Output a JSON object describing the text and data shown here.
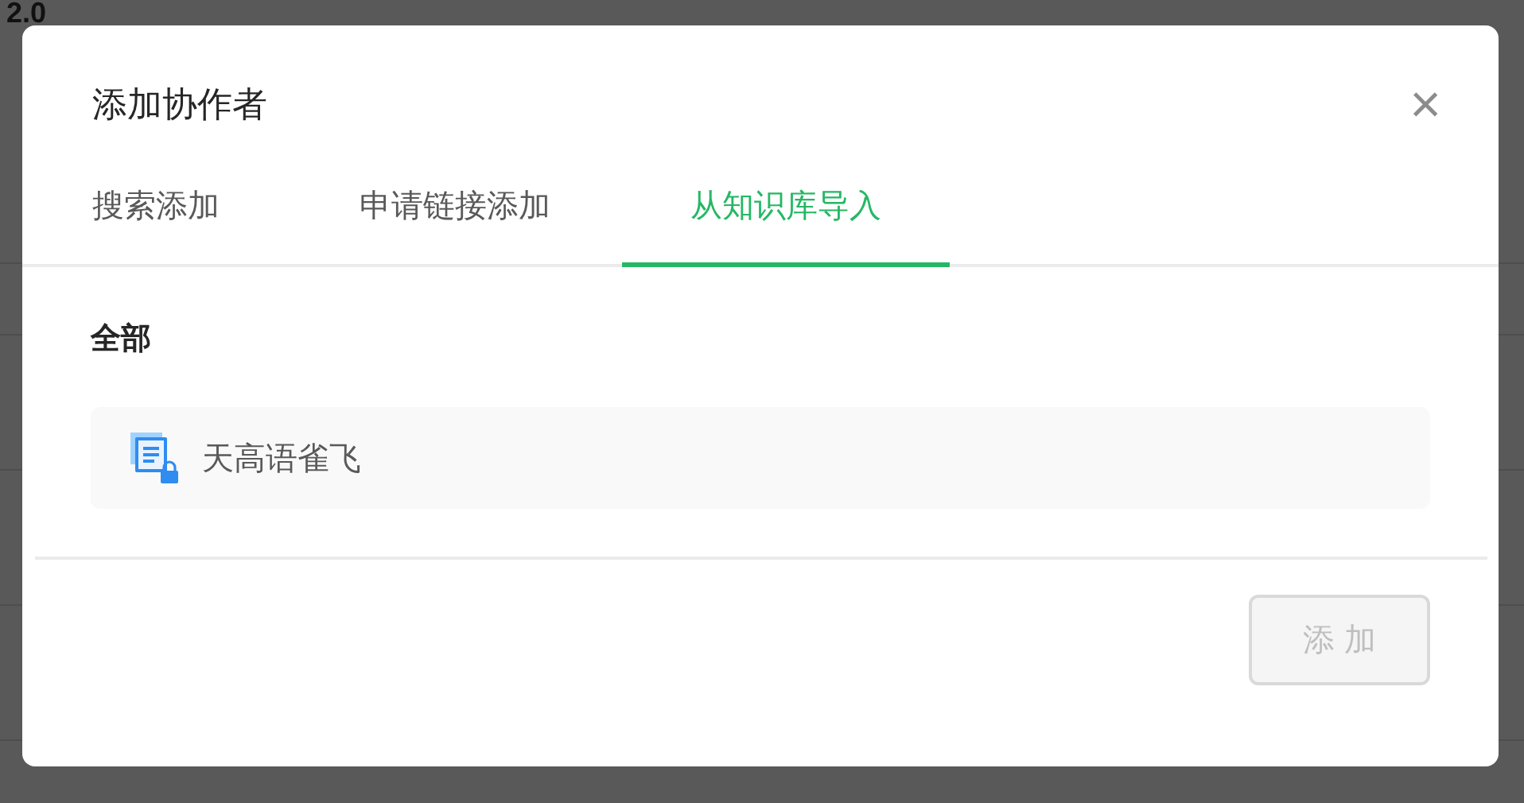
{
  "background": {
    "heading": "2.0"
  },
  "dialog": {
    "title": "添加协作者",
    "close_icon": "×"
  },
  "tabs": [
    {
      "label": "搜索添加",
      "selected": false
    },
    {
      "label": "申请链接添加",
      "selected": false
    },
    {
      "label": "从知识库导入",
      "selected": true
    }
  ],
  "section": {
    "title": "全部"
  },
  "items": [
    {
      "name": "天高语雀飞",
      "locked": true
    }
  ],
  "add_button": {
    "label": "添 加",
    "disabled": true
  }
}
